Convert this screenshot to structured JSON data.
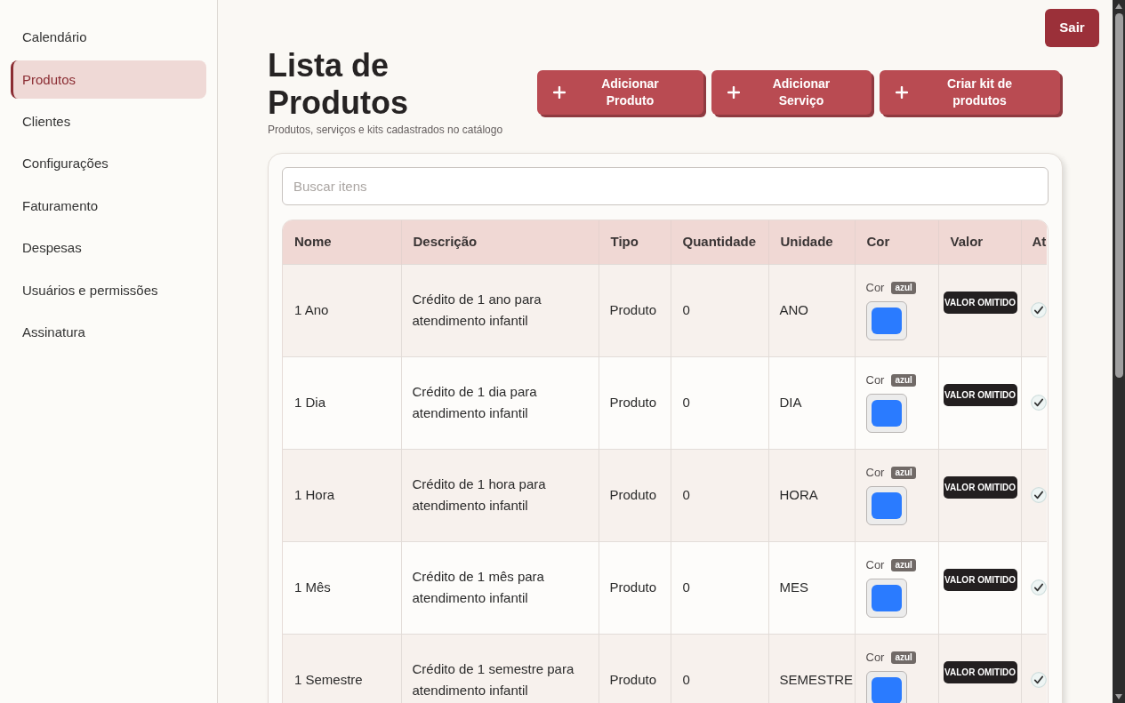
{
  "sidebar": {
    "items": [
      {
        "label": "Calendário",
        "selected": false
      },
      {
        "label": "Produtos",
        "selected": true
      },
      {
        "label": "Clientes",
        "selected": false
      },
      {
        "label": "Configurações",
        "selected": false
      },
      {
        "label": "Faturamento",
        "selected": false
      },
      {
        "label": "Despesas",
        "selected": false
      },
      {
        "label": "Usuários e permissões",
        "selected": false
      },
      {
        "label": "Assinatura",
        "selected": false
      }
    ]
  },
  "logout_button": "Sair",
  "header": {
    "title": "Lista de Produtos",
    "subtitle": "Produtos, serviços e kits cadastrados no catálogo"
  },
  "actions": [
    {
      "label": "Adicionar Produto"
    },
    {
      "label": "Adicionar Serviço"
    },
    {
      "label": "Criar kit de produtos"
    }
  ],
  "search": {
    "placeholder": "Buscar itens"
  },
  "table": {
    "columns": [
      "Nome",
      "Descrição",
      "Tipo",
      "Quantidade",
      "Unidade",
      "Cor",
      "Valor",
      "At"
    ],
    "rows": [
      {
        "name": "1 Ano",
        "description": "Crédito de 1 ano para atendimento infantil",
        "type": "Produto",
        "quantity": "0",
        "unit": "ANO",
        "color_label": "Cor",
        "color_name": "azul",
        "color": "#2a7bff",
        "value_badge": "VALOR OMITIDO",
        "active": true
      },
      {
        "name": "1 Dia",
        "description": "Crédito de 1 dia para atendimento infantil",
        "type": "Produto",
        "quantity": "0",
        "unit": "DIA",
        "color_label": "Cor",
        "color_name": "azul",
        "color": "#2a7bff",
        "value_badge": "VALOR OMITIDO",
        "active": true
      },
      {
        "name": "1 Hora",
        "description": "Crédito de 1 hora para atendimento infantil",
        "type": "Produto",
        "quantity": "0",
        "unit": "HORA",
        "color_label": "Cor",
        "color_name": "azul",
        "color": "#2a7bff",
        "value_badge": "VALOR OMITIDO",
        "active": true
      },
      {
        "name": "1 Mês",
        "description": "Crédito de 1 mês para atendimento infantil",
        "type": "Produto",
        "quantity": "0",
        "unit": "MES",
        "color_label": "Cor",
        "color_name": "azul",
        "color": "#2a7bff",
        "value_badge": "VALOR OMITIDO",
        "active": true
      },
      {
        "name": "1 Semestre",
        "description": "Crédito de 1 semestre para atendimento infantil",
        "type": "Produto",
        "quantity": "0",
        "unit": "SEMESTRE",
        "color_label": "Cor",
        "color_name": "azul",
        "color": "#2a7bff",
        "value_badge": "VALOR OMITIDO",
        "active": true
      }
    ]
  }
}
